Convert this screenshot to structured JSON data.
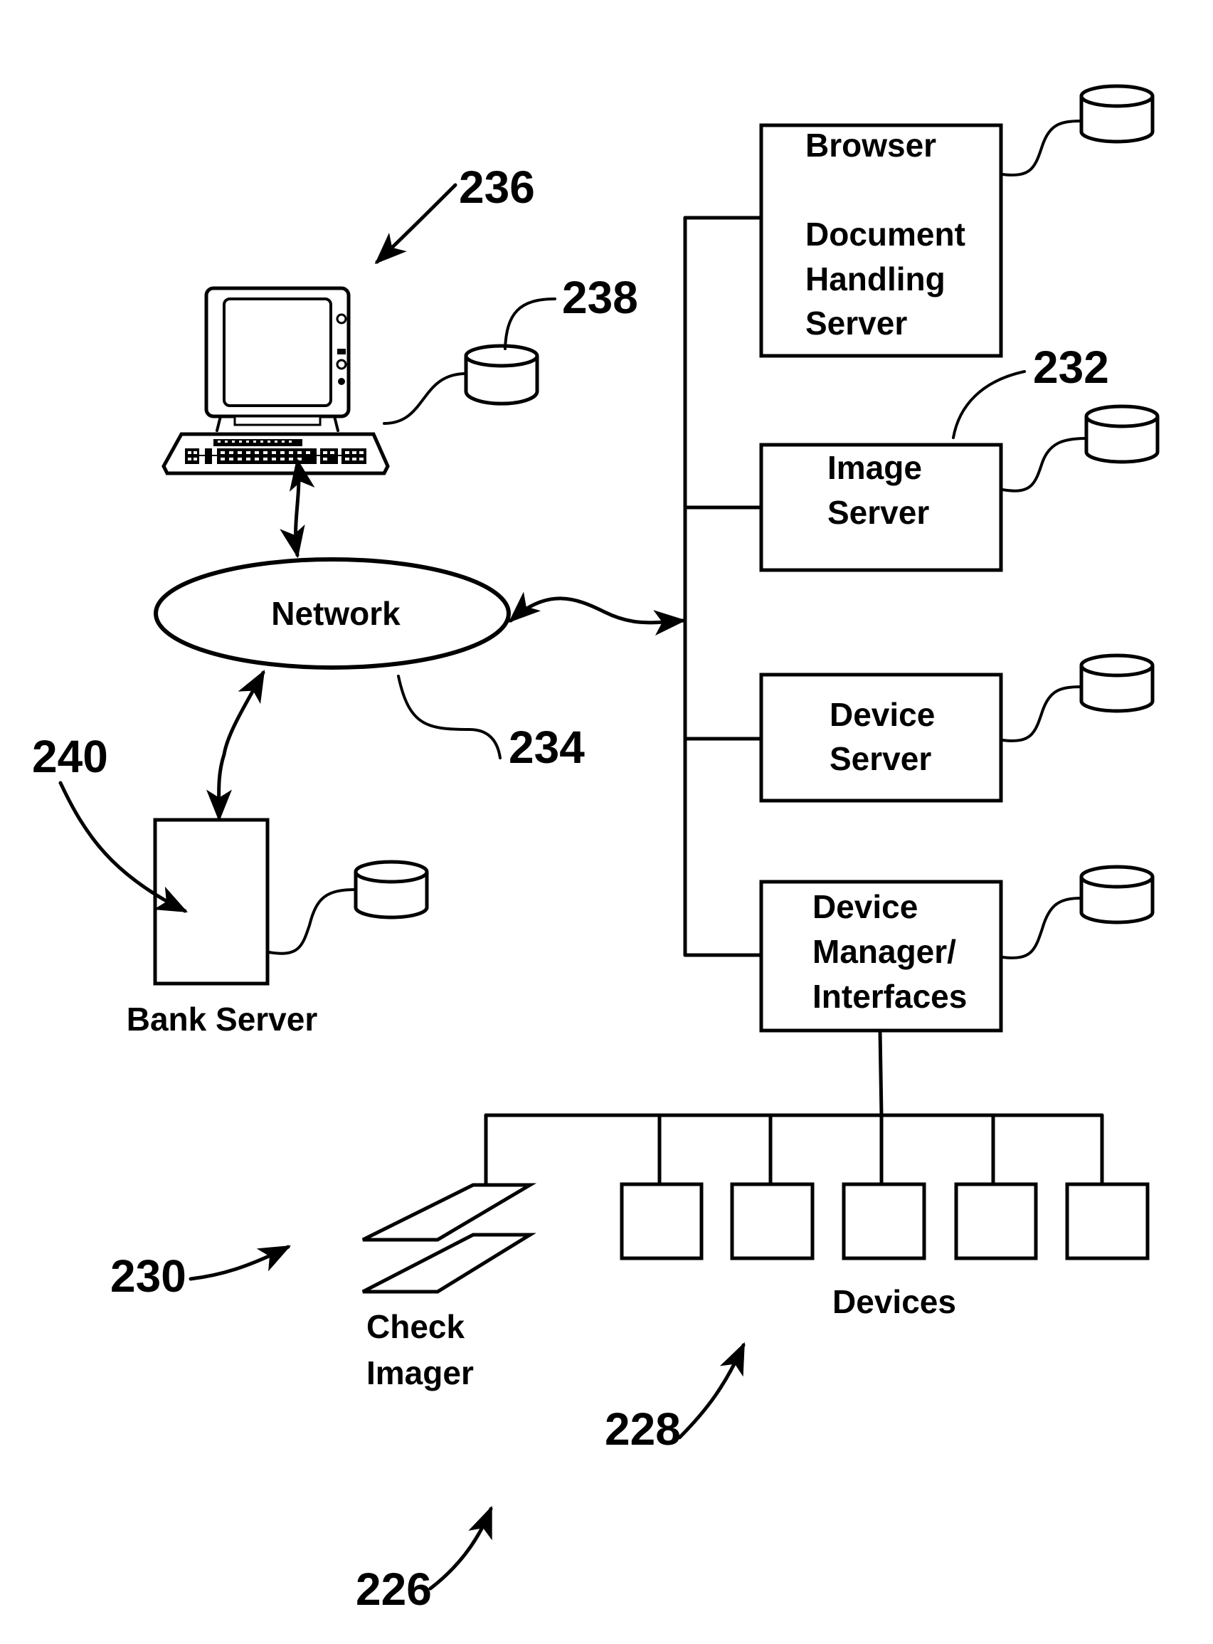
{
  "diagram": {
    "type": "network architecture patent figure",
    "nodes": {
      "browser_server": {
        "lines": [
          "Browser",
          "",
          "Document",
          "Handling",
          "Server"
        ]
      },
      "image_server": {
        "lines": [
          "Image",
          "Server"
        ],
        "ref": "232"
      },
      "device_server": {
        "lines": [
          "Device",
          "Server"
        ]
      },
      "device_manager": {
        "lines": [
          "Device",
          "Manager/",
          "Interfaces"
        ]
      },
      "network": {
        "label": "Network",
        "ref": "234"
      },
      "bank_server": {
        "label": "Bank Server",
        "ref": "240"
      },
      "workstation": {
        "ref": "236",
        "storage_ref": "238"
      },
      "check_imager": {
        "lines": [
          "Check",
          "Imager"
        ],
        "ref": "230"
      },
      "devices": {
        "label": "Devices",
        "count": 5,
        "ref": "228"
      },
      "system": {
        "ref": "226"
      }
    },
    "edges": [
      {
        "from": "workstation",
        "to": "network",
        "bidirectional": true
      },
      {
        "from": "network",
        "to": "server_bus",
        "bidirectional": true
      },
      {
        "from": "network",
        "to": "bank_server",
        "bidirectional": true
      },
      {
        "from": "server_bus",
        "to": "browser_server"
      },
      {
        "from": "server_bus",
        "to": "image_server"
      },
      {
        "from": "server_bus",
        "to": "device_server"
      },
      {
        "from": "server_bus",
        "to": "device_manager"
      },
      {
        "from": "device_manager",
        "to": "device_bus"
      },
      {
        "from": "device_bus",
        "to": "check_imager"
      },
      {
        "from": "device_bus",
        "to": "devices"
      }
    ]
  }
}
